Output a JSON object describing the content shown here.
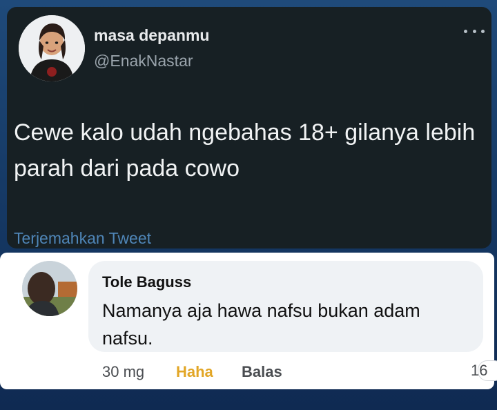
{
  "tweet": {
    "display_name": "masa depanmu",
    "handle": "@EnakNastar",
    "text": "Cewe kalo udah ngebahas 18+ gilanya lebih parah dari pada cowo",
    "translate_label": "Terjemahkan Tweet",
    "more_icon": "more-horizontal-icon"
  },
  "comment": {
    "author": "Tole Baguss",
    "text": "Namanya aja hawa nafsu bukan adam nafsu.",
    "time": "30 mg",
    "reaction_label": "Haha",
    "reply_label": "Balas",
    "reaction_count": "16"
  },
  "colors": {
    "tweet_background": "#172024",
    "link": "#4f86b8",
    "haha": "#e2a626"
  }
}
